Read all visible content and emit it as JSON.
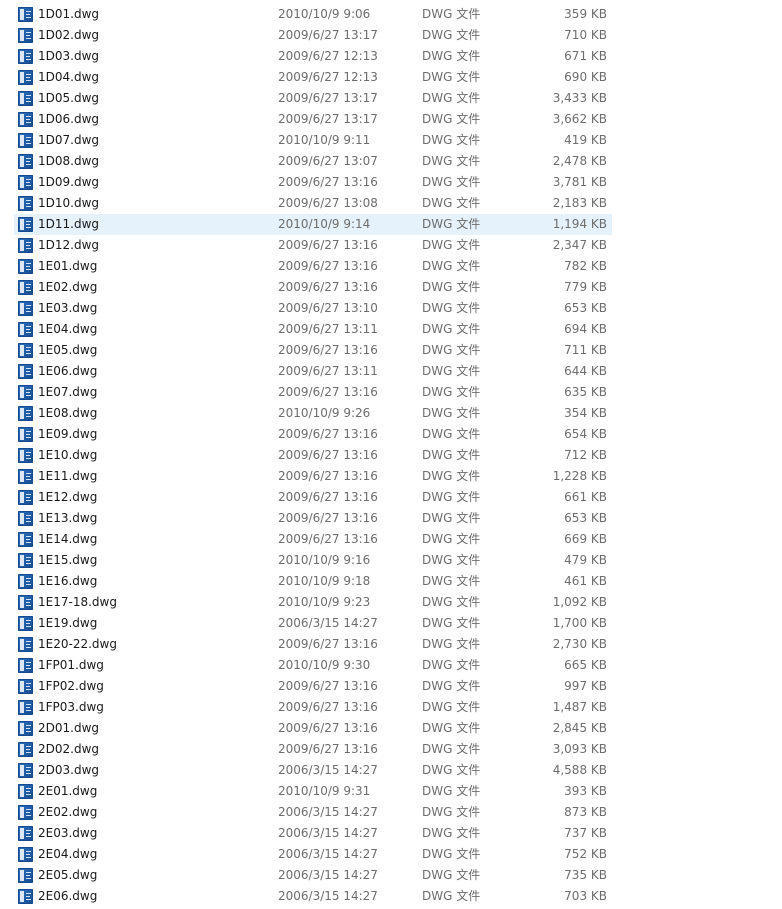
{
  "files": [
    {
      "name": "1D01.dwg",
      "modified": "2010/10/9 9:06",
      "type": "DWG 文件",
      "size": "359 KB"
    },
    {
      "name": "1D02.dwg",
      "modified": "2009/6/27 13:17",
      "type": "DWG 文件",
      "size": "710 KB"
    },
    {
      "name": "1D03.dwg",
      "modified": "2009/6/27 12:13",
      "type": "DWG 文件",
      "size": "671 KB"
    },
    {
      "name": "1D04.dwg",
      "modified": "2009/6/27 12:13",
      "type": "DWG 文件",
      "size": "690 KB"
    },
    {
      "name": "1D05.dwg",
      "modified": "2009/6/27 13:17",
      "type": "DWG 文件",
      "size": "3,433 KB"
    },
    {
      "name": "1D06.dwg",
      "modified": "2009/6/27 13:17",
      "type": "DWG 文件",
      "size": "3,662 KB"
    },
    {
      "name": "1D07.dwg",
      "modified": "2010/10/9 9:11",
      "type": "DWG 文件",
      "size": "419 KB"
    },
    {
      "name": "1D08.dwg",
      "modified": "2009/6/27 13:07",
      "type": "DWG 文件",
      "size": "2,478 KB"
    },
    {
      "name": "1D09.dwg",
      "modified": "2009/6/27 13:16",
      "type": "DWG 文件",
      "size": "3,781 KB"
    },
    {
      "name": "1D10.dwg",
      "modified": "2009/6/27 13:08",
      "type": "DWG 文件",
      "size": "2,183 KB"
    },
    {
      "name": "1D11.dwg",
      "modified": "2010/10/9 9:14",
      "type": "DWG 文件",
      "size": "1,194 KB",
      "selected": true
    },
    {
      "name": "1D12.dwg",
      "modified": "2009/6/27 13:16",
      "type": "DWG 文件",
      "size": "2,347 KB"
    },
    {
      "name": "1E01.dwg",
      "modified": "2009/6/27 13:16",
      "type": "DWG 文件",
      "size": "782 KB"
    },
    {
      "name": "1E02.dwg",
      "modified": "2009/6/27 13:16",
      "type": "DWG 文件",
      "size": "779 KB"
    },
    {
      "name": "1E03.dwg",
      "modified": "2009/6/27 13:10",
      "type": "DWG 文件",
      "size": "653 KB"
    },
    {
      "name": "1E04.dwg",
      "modified": "2009/6/27 13:11",
      "type": "DWG 文件",
      "size": "694 KB"
    },
    {
      "name": "1E05.dwg",
      "modified": "2009/6/27 13:16",
      "type": "DWG 文件",
      "size": "711 KB"
    },
    {
      "name": "1E06.dwg",
      "modified": "2009/6/27 13:11",
      "type": "DWG 文件",
      "size": "644 KB"
    },
    {
      "name": "1E07.dwg",
      "modified": "2009/6/27 13:16",
      "type": "DWG 文件",
      "size": "635 KB"
    },
    {
      "name": "1E08.dwg",
      "modified": "2010/10/9 9:26",
      "type": "DWG 文件",
      "size": "354 KB"
    },
    {
      "name": "1E09.dwg",
      "modified": "2009/6/27 13:16",
      "type": "DWG 文件",
      "size": "654 KB"
    },
    {
      "name": "1E10.dwg",
      "modified": "2009/6/27 13:16",
      "type": "DWG 文件",
      "size": "712 KB"
    },
    {
      "name": "1E11.dwg",
      "modified": "2009/6/27 13:16",
      "type": "DWG 文件",
      "size": "1,228 KB"
    },
    {
      "name": "1E12.dwg",
      "modified": "2009/6/27 13:16",
      "type": "DWG 文件",
      "size": "661 KB"
    },
    {
      "name": "1E13.dwg",
      "modified": "2009/6/27 13:16",
      "type": "DWG 文件",
      "size": "653 KB"
    },
    {
      "name": "1E14.dwg",
      "modified": "2009/6/27 13:16",
      "type": "DWG 文件",
      "size": "669 KB"
    },
    {
      "name": "1E15.dwg",
      "modified": "2010/10/9 9:16",
      "type": "DWG 文件",
      "size": "479 KB"
    },
    {
      "name": "1E16.dwg",
      "modified": "2010/10/9 9:18",
      "type": "DWG 文件",
      "size": "461 KB"
    },
    {
      "name": "1E17-18.dwg",
      "modified": "2010/10/9 9:23",
      "type": "DWG 文件",
      "size": "1,092 KB"
    },
    {
      "name": "1E19.dwg",
      "modified": "2006/3/15 14:27",
      "type": "DWG 文件",
      "size": "1,700 KB"
    },
    {
      "name": "1E20-22.dwg",
      "modified": "2009/6/27 13:16",
      "type": "DWG 文件",
      "size": "2,730 KB"
    },
    {
      "name": "1FP01.dwg",
      "modified": "2010/10/9 9:30",
      "type": "DWG 文件",
      "size": "665 KB"
    },
    {
      "name": "1FP02.dwg",
      "modified": "2009/6/27 13:16",
      "type": "DWG 文件",
      "size": "997 KB"
    },
    {
      "name": "1FP03.dwg",
      "modified": "2009/6/27 13:16",
      "type": "DWG 文件",
      "size": "1,487 KB"
    },
    {
      "name": "2D01.dwg",
      "modified": "2009/6/27 13:16",
      "type": "DWG 文件",
      "size": "2,845 KB"
    },
    {
      "name": "2D02.dwg",
      "modified": "2009/6/27 13:16",
      "type": "DWG 文件",
      "size": "3,093 KB"
    },
    {
      "name": "2D03.dwg",
      "modified": "2006/3/15 14:27",
      "type": "DWG 文件",
      "size": "4,588 KB"
    },
    {
      "name": "2E01.dwg",
      "modified": "2010/10/9 9:31",
      "type": "DWG 文件",
      "size": "393 KB"
    },
    {
      "name": "2E02.dwg",
      "modified": "2006/3/15 14:27",
      "type": "DWG 文件",
      "size": "873 KB"
    },
    {
      "name": "2E03.dwg",
      "modified": "2006/3/15 14:27",
      "type": "DWG 文件",
      "size": "737 KB"
    },
    {
      "name": "2E04.dwg",
      "modified": "2006/3/15 14:27",
      "type": "DWG 文件",
      "size": "752 KB"
    },
    {
      "name": "2E05.dwg",
      "modified": "2006/3/15 14:27",
      "type": "DWG 文件",
      "size": "735 KB"
    },
    {
      "name": "2E06.dwg",
      "modified": "2006/3/15 14:27",
      "type": "DWG 文件",
      "size": "703 KB"
    }
  ],
  "icons": {
    "file": "dwg-file-icon"
  },
  "colors": {
    "selection": "#e5f1fb",
    "icon_blue": "#1f5aa6",
    "secondary_text": "#6d6d6d"
  }
}
